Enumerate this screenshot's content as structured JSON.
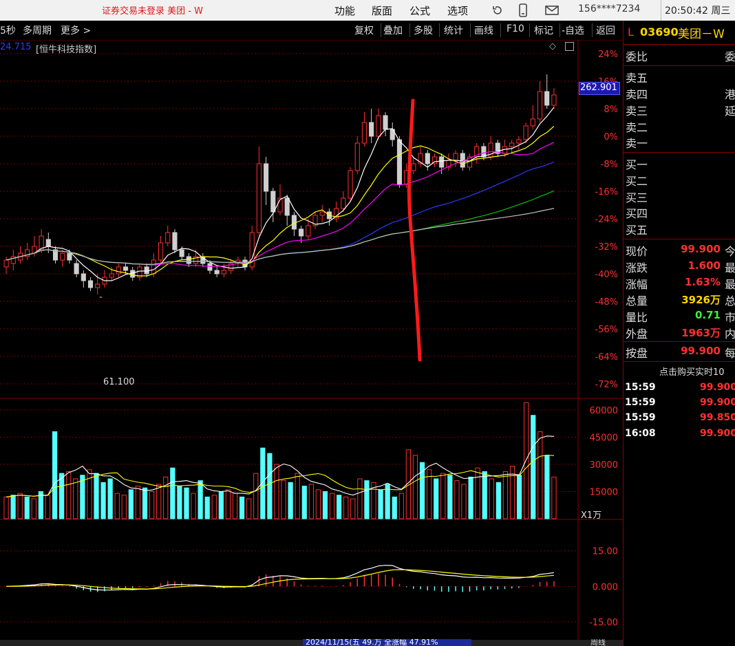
{
  "titlebar": {
    "app_title": "证券交易未登录  美团 - W",
    "menus": [
      "功能",
      "版面",
      "公式",
      "选项"
    ],
    "user": "156****7234",
    "clock": "20:50:42 周三"
  },
  "toolbar": {
    "left_items": [
      "5秒",
      "多周期",
      "更多 >"
    ],
    "right_items": [
      "复权",
      "叠加",
      "多股",
      "统计",
      "画线",
      "F10",
      "标记",
      "-自选",
      "返回"
    ]
  },
  "overlay": {
    "value": "24.715",
    "index_name": "[恒牛科技指数]",
    "last_price_badge": "262.901",
    "min_marker": "61.100"
  },
  "bottom_tabs": {
    "status": "2024/11/15(五 49.万 全涨幅 47.91%",
    "right": "周线"
  },
  "sidebar": {
    "stock_code": "03690",
    "stock_name": "美团－W",
    "prefix": "L",
    "webi_label": "委比",
    "webi_right": "委",
    "sell_levels": [
      "卖五",
      "卖四",
      "卖三",
      "卖二",
      "卖一"
    ],
    "buy_levels": [
      "买一",
      "买二",
      "买三",
      "买四",
      "买五"
    ],
    "side_notes": [
      "港",
      "延"
    ],
    "quote": [
      {
        "label": "现价",
        "value": "99.900",
        "right": "今",
        "color": "red"
      },
      {
        "label": "涨跌",
        "value": "1.600",
        "right": "最",
        "color": "red"
      },
      {
        "label": "涨幅",
        "value": "1.63%",
        "right": "最",
        "color": "red"
      },
      {
        "label": "总量",
        "value": "3926万",
        "right": "总",
        "color": "yel"
      },
      {
        "label": "量比",
        "value": "0.71",
        "right": "市",
        "color": "grn"
      },
      {
        "label": "外盘",
        "value": "1963万",
        "right": "内",
        "color": "red"
      }
    ],
    "pan": {
      "label": "按盘",
      "value": "99.900",
      "right": "每"
    },
    "ticks_header": "点击购买实时10",
    "ticks": [
      {
        "time": "15:59",
        "price": "99.900"
      },
      {
        "time": "15:59",
        "price": "99.900"
      },
      {
        "time": "15:59",
        "price": "99.850"
      },
      {
        "time": "16:08",
        "price": "99.900"
      }
    ]
  },
  "colors": {
    "up": "#ff3030",
    "down": "#54ffff",
    "ma5": "#ffffff",
    "ma10": "#ffff00",
    "ma20": "#ff00ff",
    "ma60": "#2d3bff",
    "ma120": "#00c800",
    "ma250": "#c0c0c0",
    "grid": "#7a0000"
  },
  "chart_data": [
    {
      "type": "candlestick",
      "title": "",
      "y_ticks": [
        "24%",
        "16%",
        "8%",
        "0%",
        "-8%",
        "-16%",
        "-24%",
        "-32%",
        "-40%",
        "-48%",
        "-56%",
        "-64%",
        "-72%"
      ],
      "ylim": [
        -76,
        26
      ],
      "low_marker": "61.100",
      "candles": [
        [
          -38,
          -36,
          -35,
          -40
        ],
        [
          -37,
          -35,
          -33,
          -39
        ],
        [
          -36,
          -34,
          -32,
          -37
        ],
        [
          -35,
          -33,
          -31,
          -36
        ],
        [
          -34,
          -32,
          -29,
          -35
        ],
        [
          -33,
          -29,
          -27,
          -34
        ],
        [
          -30,
          -32,
          -28,
          -34
        ],
        [
          -33,
          -36,
          -32,
          -37
        ],
        [
          -36,
          -34,
          -33,
          -38
        ],
        [
          -34,
          -36,
          -33,
          -37
        ],
        [
          -37,
          -40,
          -36,
          -41
        ],
        [
          -40,
          -42,
          -39,
          -44
        ],
        [
          -42,
          -44,
          -41,
          -45
        ],
        [
          -44,
          -43,
          -40,
          -46
        ],
        [
          -43,
          -41,
          -39,
          -44
        ],
        [
          -41,
          -40,
          -38,
          -42
        ],
        [
          -40,
          -38,
          -37,
          -41
        ],
        [
          -38,
          -39,
          -37,
          -40
        ],
        [
          -39,
          -41,
          -38,
          -42
        ],
        [
          -41,
          -38,
          -37,
          -42
        ],
        [
          -38,
          -40,
          -37,
          -41
        ],
        [
          -40,
          -36,
          -34,
          -41
        ],
        [
          -36,
          -31,
          -29,
          -37
        ],
        [
          -31,
          -28,
          -26,
          -32
        ],
        [
          -28,
          -33,
          -27,
          -34
        ],
        [
          -33,
          -35,
          -32,
          -36
        ],
        [
          -35,
          -37,
          -34,
          -38
        ],
        [
          -37,
          -35,
          -33,
          -38
        ],
        [
          -35,
          -37,
          -34,
          -38
        ],
        [
          -37,
          -39,
          -36,
          -40
        ],
        [
          -39,
          -40,
          -38,
          -41
        ],
        [
          -40,
          -39,
          -37,
          -41
        ],
        [
          -39,
          -37,
          -36,
          -40
        ],
        [
          -37,
          -36,
          -35,
          -38
        ],
        [
          -36,
          -38,
          -35,
          -39
        ],
        [
          -38,
          -28,
          -26,
          -39
        ],
        [
          -28,
          -8,
          -3,
          -29
        ],
        [
          -8,
          -16,
          -6,
          -20
        ],
        [
          -16,
          -22,
          -15,
          -25
        ],
        [
          -22,
          -18,
          -14,
          -23
        ],
        [
          -18,
          -23,
          -17,
          -26
        ],
        [
          -23,
          -27,
          -22,
          -29
        ],
        [
          -27,
          -29,
          -26,
          -31
        ],
        [
          -29,
          -26,
          -24,
          -30
        ],
        [
          -26,
          -23,
          -22,
          -27
        ],
        [
          -23,
          -22,
          -20,
          -25
        ],
        [
          -22,
          -24,
          -21,
          -26
        ],
        [
          -24,
          -21,
          -19,
          -25
        ],
        [
          -21,
          -18,
          -16,
          -22
        ],
        [
          -18,
          -10,
          -9,
          -19
        ],
        [
          -10,
          -2,
          0,
          -11
        ],
        [
          -2,
          4,
          7,
          -3
        ],
        [
          4,
          0,
          8,
          -2
        ],
        [
          0,
          6,
          8,
          -1
        ],
        [
          6,
          2,
          7,
          0
        ],
        [
          2,
          -1,
          4,
          -3
        ],
        [
          -1,
          -14,
          0,
          -15
        ],
        [
          -14,
          -10,
          -8,
          -15
        ],
        [
          -10,
          -8,
          -6,
          -11
        ],
        [
          -8,
          -5,
          -3,
          -9
        ],
        [
          -5,
          -8,
          -4,
          -10
        ],
        [
          -8,
          -6,
          -5,
          -9
        ],
        [
          -6,
          -9,
          -5,
          -11
        ],
        [
          -9,
          -7,
          -5,
          -10
        ],
        [
          -7,
          -5,
          -4,
          -9
        ],
        [
          -5,
          -9,
          -4,
          -10
        ],
        [
          -9,
          -6,
          -5,
          -10
        ],
        [
          -6,
          -3,
          -2,
          -8
        ],
        [
          -3,
          -6,
          -2,
          -7
        ],
        [
          -6,
          -2,
          0,
          -7
        ],
        [
          -2,
          -5,
          -1,
          -6
        ],
        [
          -5,
          -3,
          -1,
          -6
        ],
        [
          -3,
          -2,
          -1,
          -5
        ],
        [
          -2,
          -1,
          0,
          -4
        ],
        [
          -1,
          3,
          4,
          -2
        ],
        [
          3,
          5,
          9,
          2
        ],
        [
          5,
          13,
          16,
          4
        ],
        [
          13,
          9,
          18,
          8
        ],
        [
          9,
          12,
          14,
          8
        ]
      ],
      "ma_series": [
        {
          "name": "MA5",
          "color": "#ffffff"
        },
        {
          "name": "MA10",
          "color": "#ffff00"
        },
        {
          "name": "MA20",
          "color": "#ff00ff"
        },
        {
          "name": "MA60",
          "color": "#2d3bff"
        },
        {
          "name": "MA120",
          "color": "#00c800"
        },
        {
          "name": "MA250",
          "color": "#c0c0c0"
        }
      ]
    },
    {
      "type": "bar",
      "title": "",
      "y_ticks": [
        "60000",
        "45000",
        "30000",
        "15000"
      ],
      "unit_label": "X1万",
      "ylim": [
        0,
        66000
      ],
      "values": [
        12000,
        13000,
        14000,
        12000,
        11000,
        15000,
        13000,
        48000,
        25000,
        26000,
        22000,
        24000,
        27000,
        25000,
        20000,
        22000,
        14000,
        13000,
        16000,
        18000,
        17000,
        15000,
        19000,
        23000,
        28000,
        18000,
        17000,
        14000,
        21000,
        12000,
        13000,
        15000,
        16000,
        14000,
        12000,
        11000,
        25000,
        39000,
        36000,
        30000,
        21000,
        20000,
        25000,
        18000,
        19000,
        16000,
        15000,
        14000,
        13000,
        12000,
        11000,
        22000,
        21000,
        20000,
        16000,
        19000,
        12000,
        14000,
        38000,
        35000,
        31000,
        27000,
        22000,
        25000,
        24000,
        21000,
        19000,
        23000,
        28000,
        26000,
        22000,
        20000,
        26000,
        29000,
        24000,
        64000,
        57000,
        48000,
        35000,
        23000
      ],
      "up": [
        1,
        0,
        1,
        0,
        1,
        0,
        1,
        0,
        0,
        1,
        1,
        0,
        1,
        0,
        0,
        0,
        1,
        1,
        0,
        1,
        0,
        1,
        1,
        1,
        0,
        0,
        0,
        1,
        0,
        0,
        1,
        0,
        1,
        1,
        0,
        1,
        1,
        0,
        0,
        1,
        1,
        0,
        1,
        0,
        1,
        1,
        0,
        1,
        0,
        1,
        1,
        1,
        0,
        1,
        0,
        0,
        0,
        1,
        1,
        1,
        0,
        1,
        0,
        1,
        0,
        1,
        1,
        0,
        1,
        0,
        1,
        0,
        1,
        1,
        0,
        1,
        0,
        1,
        0,
        1
      ]
    },
    {
      "type": "bar",
      "title": "",
      "y_ticks": [
        "15.00",
        "0.000",
        "-15.00"
      ],
      "ylim": [
        -22,
        28
      ]
    }
  ]
}
